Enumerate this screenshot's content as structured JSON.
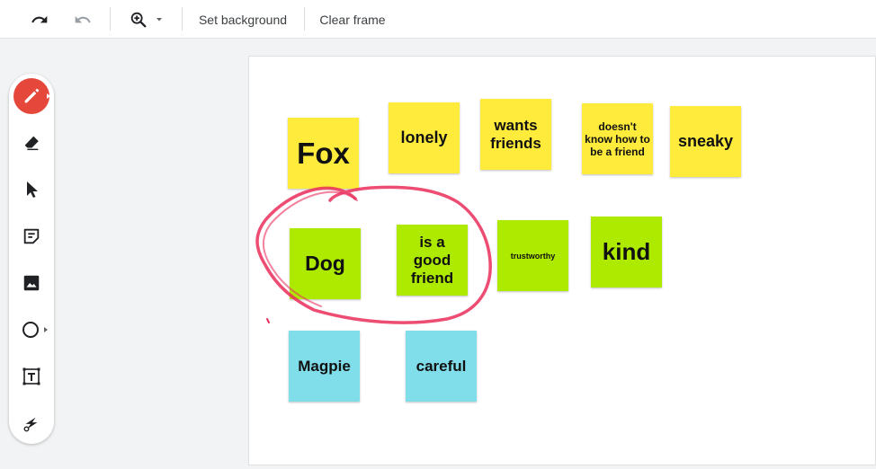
{
  "toolbar": {
    "undo_icon": "undo-icon",
    "redo_icon": "redo-icon",
    "zoom_icon": "zoom-in-icon",
    "set_background_label": "Set background",
    "clear_frame_label": "Clear frame"
  },
  "tools": [
    {
      "name": "pen-icon",
      "active": true
    },
    {
      "name": "eraser-icon"
    },
    {
      "name": "select-pointer-icon"
    },
    {
      "name": "sticky-note-icon"
    },
    {
      "name": "image-icon"
    },
    {
      "name": "circle-shape-icon"
    },
    {
      "name": "text-box-icon"
    },
    {
      "name": "laser-pointer-icon"
    }
  ],
  "notes": {
    "fox": "Fox",
    "lonely": "lonely",
    "wants_friends": "wants friends",
    "doesnt_know": "doesn't know how to be a friend",
    "sneaky": "sneaky",
    "dog": "Dog",
    "good_friend": "is a good friend",
    "trustworthy": "trustworthy",
    "kind": "kind",
    "magpie": "Magpie",
    "careful": "careful"
  },
  "colors": {
    "yellow": "#ffeb3b",
    "green": "#aeea00",
    "cyan": "#80deea",
    "pen": "#ea2e5b",
    "active_tool": "#e5483a"
  }
}
